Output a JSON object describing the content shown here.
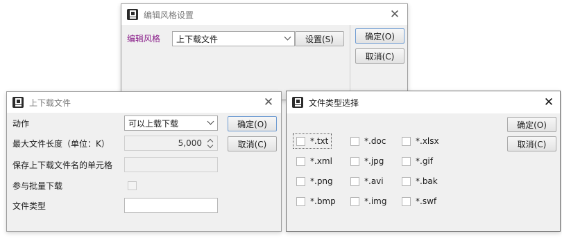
{
  "style_dialog": {
    "title": "编辑风格设置",
    "label": "编辑风格",
    "label_color": "#8a1f8a",
    "style_value": "上下载文件",
    "settings_button": "设置(S)",
    "ok_button": "确定(O)",
    "cancel_button": "取消(C)"
  },
  "upload_dialog": {
    "title": "上下载文件",
    "fields": {
      "action_label": "动作",
      "action_value": "可以上载下载",
      "maxlen_label": "最大文件长度（单位：K）",
      "maxlen_value": "5,000",
      "cellname_label": "保存上下载文件名的单元格",
      "batch_label": "参与批量下载",
      "filetype_label": "文件类型"
    },
    "ok_button": "确定(O)",
    "cancel_button": "取消(C)"
  },
  "filetype_dialog": {
    "title": "文件类型选择",
    "options": [
      {
        "label": "*.txt",
        "checked": false
      },
      {
        "label": "*.doc",
        "checked": false
      },
      {
        "label": "*.xlsx",
        "checked": false
      },
      {
        "label": "*.xml",
        "checked": false
      },
      {
        "label": "*.jpg",
        "checked": false
      },
      {
        "label": "*.gif",
        "checked": false
      },
      {
        "label": "*.png",
        "checked": false
      },
      {
        "label": "*.avi",
        "checked": false
      },
      {
        "label": "*.bak",
        "checked": false
      },
      {
        "label": "*.bmp",
        "checked": false
      },
      {
        "label": "*.img",
        "checked": false
      },
      {
        "label": "*.swf",
        "checked": false
      }
    ],
    "ok_button": "确定(O)",
    "cancel_button": "取消(C)"
  }
}
